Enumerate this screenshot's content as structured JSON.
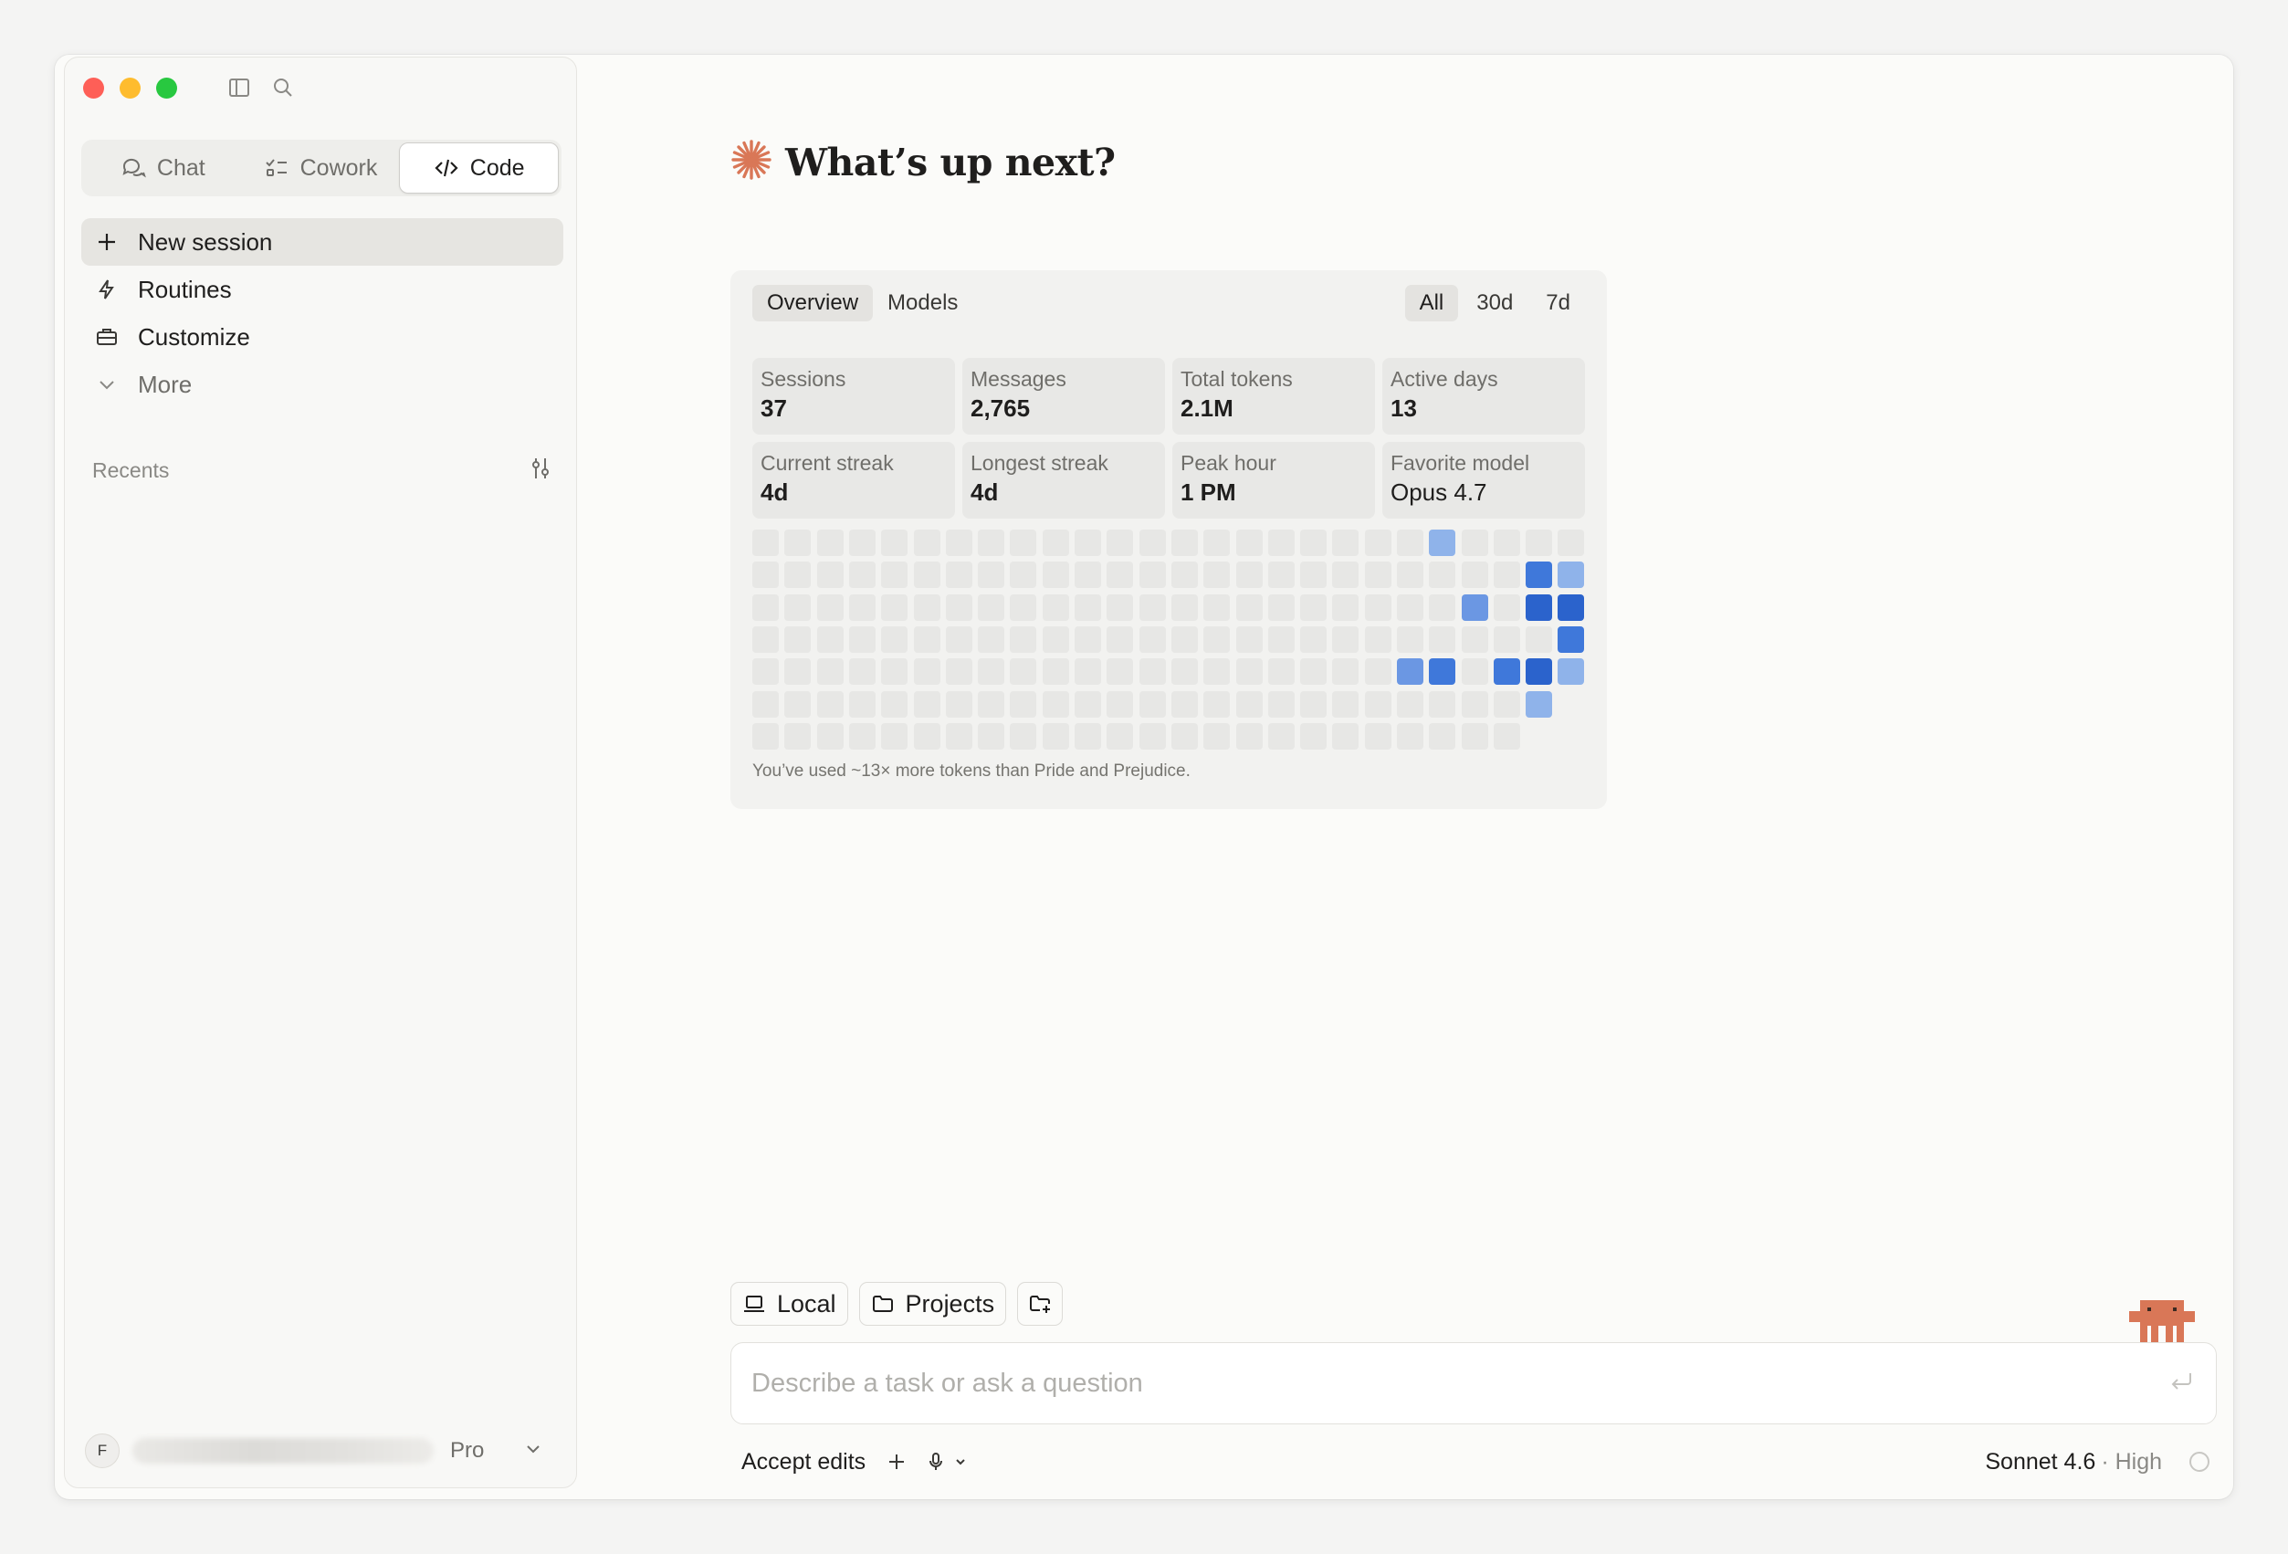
{
  "sidebar": {
    "modes": [
      {
        "label": "Chat",
        "icon": "chat-bubbles-icon"
      },
      {
        "label": "Cowork",
        "icon": "checklist-icon"
      },
      {
        "label": "Code",
        "icon": "code-icon",
        "active": true
      }
    ],
    "nav": [
      {
        "label": "New session",
        "icon": "plus-icon",
        "active": true
      },
      {
        "label": "Routines",
        "icon": "lightning-icon"
      },
      {
        "label": "Customize",
        "icon": "briefcase-icon"
      },
      {
        "label": "More",
        "icon": "chevron-down-icon"
      }
    ],
    "recents_label": "Recents",
    "account": {
      "avatar_initial": "F",
      "plan": "Pro"
    }
  },
  "main": {
    "heading": "What’s up next?",
    "stats": {
      "tabs": [
        "Overview",
        "Models"
      ],
      "ranges": [
        "All",
        "30d",
        "7d"
      ],
      "active_tab": "Overview",
      "active_range": "All",
      "cards": [
        {
          "label": "Sessions",
          "value": "37"
        },
        {
          "label": "Messages",
          "value": "2,765"
        },
        {
          "label": "Total tokens",
          "value": "2.1M"
        },
        {
          "label": "Active days",
          "value": "13"
        },
        {
          "label": "Current streak",
          "value": "4d"
        },
        {
          "label": "Longest streak",
          "value": "4d"
        },
        {
          "label": "Peak hour",
          "value": "1 PM"
        },
        {
          "label": "Favorite model",
          "value": "Opus 4.7"
        }
      ],
      "heatmap": {
        "weeks": 26,
        "days": 7,
        "colors": {
          "0": "#e7e7e5",
          "1": "#8fb3ea",
          "2": "#6b97e3",
          "3": "#3f78da",
          "4": "#2b63cc"
        },
        "active": [
          {
            "week": 21,
            "day": 0,
            "level": 1
          },
          {
            "week": 24,
            "day": 1,
            "level": 3
          },
          {
            "week": 25,
            "day": 1,
            "level": 1
          },
          {
            "week": 22,
            "day": 2,
            "level": 2
          },
          {
            "week": 24,
            "day": 2,
            "level": 4
          },
          {
            "week": 25,
            "day": 2,
            "level": 4
          },
          {
            "week": 25,
            "day": 3,
            "level": 3
          },
          {
            "week": 20,
            "day": 4,
            "level": 2
          },
          {
            "week": 21,
            "day": 4,
            "level": 3
          },
          {
            "week": 23,
            "day": 4,
            "level": 3
          },
          {
            "week": 24,
            "day": 4,
            "level": 4
          },
          {
            "week": 25,
            "day": 4,
            "level": 1
          },
          {
            "week": 24,
            "day": 5,
            "level": 1
          }
        ],
        "last_week_days": 7,
        "current_week_days": 6
      },
      "note": "You’ve used ~13× more tokens than Pride and Prejudice."
    },
    "composer": {
      "chips": [
        {
          "label": "Local",
          "icon": "laptop-icon"
        },
        {
          "label": "Projects",
          "icon": "folder-icon"
        },
        {
          "label": "",
          "icon": "folder-plus-icon"
        }
      ],
      "placeholder": "Describe a task or ask a question",
      "accept_label": "Accept edits",
      "model": "Sonnet 4.6",
      "effort": "· High"
    },
    "accent_color": "#d97757"
  }
}
